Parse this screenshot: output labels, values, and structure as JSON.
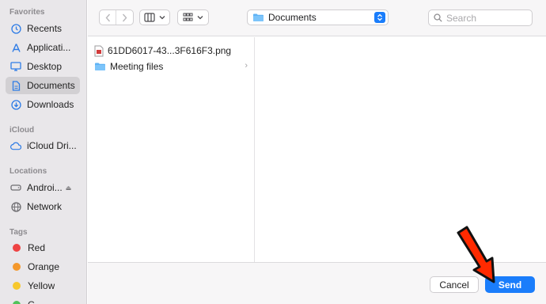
{
  "sidebar": {
    "favorites_header": "Favorites",
    "favorites": [
      {
        "label": "Recents",
        "icon": "clock-icon"
      },
      {
        "label": "Applicati...",
        "icon": "applications-icon"
      },
      {
        "label": "Desktop",
        "icon": "desktop-icon"
      },
      {
        "label": "Documents",
        "icon": "document-icon",
        "selected": true
      },
      {
        "label": "Downloads",
        "icon": "download-icon"
      }
    ],
    "icloud_header": "iCloud",
    "icloud": [
      {
        "label": "iCloud Dri...",
        "icon": "cloud-icon"
      }
    ],
    "locations_header": "Locations",
    "locations": [
      {
        "label": "Androi...",
        "icon": "drive-icon",
        "eject": "⏏"
      },
      {
        "label": "Network",
        "icon": "network-icon"
      }
    ],
    "tags_header": "Tags",
    "tags": [
      {
        "label": "Red",
        "color": "#ee4343"
      },
      {
        "label": "Orange",
        "color": "#f4982c"
      },
      {
        "label": "Yellow",
        "color": "#f7c82d"
      },
      {
        "label": "G",
        "color": "#52c35a"
      }
    ]
  },
  "toolbar": {
    "location": "Documents",
    "search_placeholder": "Search"
  },
  "files": [
    {
      "name": "61DD6017-43...3F616F3.png",
      "type": "image-file"
    },
    {
      "name": "Meeting files",
      "type": "folder"
    }
  ],
  "buttons": {
    "cancel": "Cancel",
    "send": "Send"
  },
  "colors": {
    "accent": "#1a7dfb",
    "annotation_arrow": "#ff2a00"
  }
}
